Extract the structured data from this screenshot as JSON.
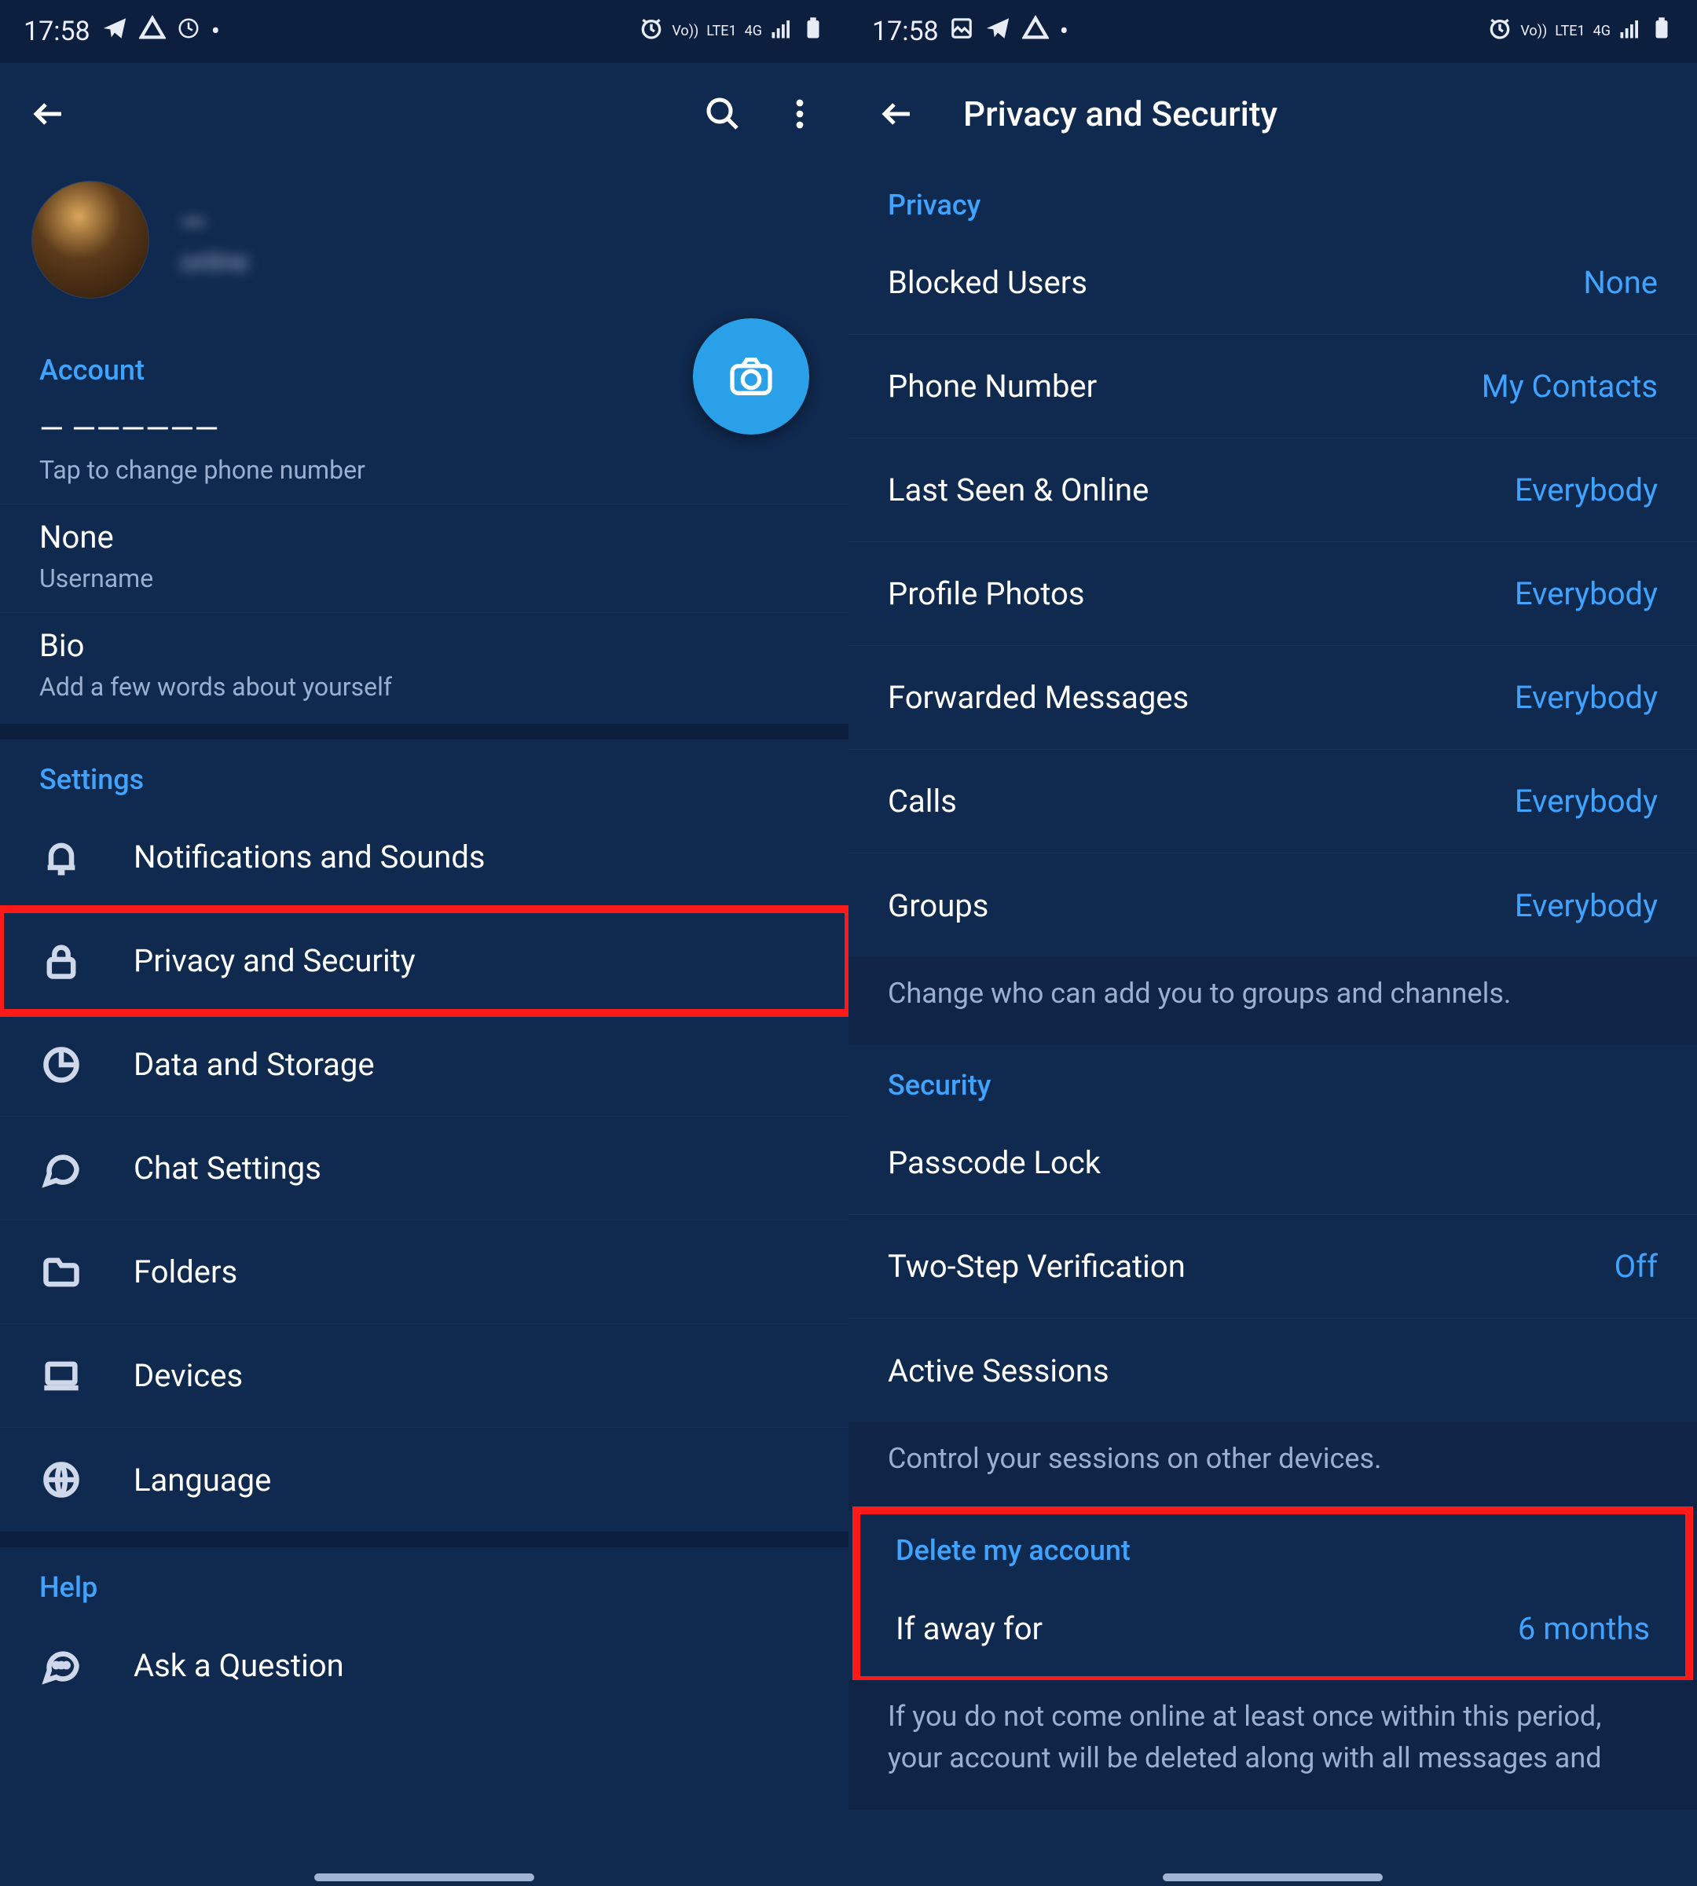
{
  "status": {
    "time": "17:58",
    "vo": "Vo))",
    "lte": "LTE1",
    "net": "4G",
    "dot": "•"
  },
  "left": {
    "profile": {
      "name": "—",
      "sub": "online"
    },
    "account": {
      "header": "Account",
      "phone_value": "— ——————",
      "phone_sub": "Tap to change phone number",
      "username_value": "None",
      "username_label": "Username",
      "bio_value": "Bio",
      "bio_sub": "Add a few words about yourself"
    },
    "settings": {
      "header": "Settings",
      "items": [
        {
          "label": "Notifications and Sounds",
          "icon": "bell"
        },
        {
          "label": "Privacy and Security",
          "icon": "lock",
          "highlight": true
        },
        {
          "label": "Data and Storage",
          "icon": "pie"
        },
        {
          "label": "Chat Settings",
          "icon": "chat"
        },
        {
          "label": "Folders",
          "icon": "folder"
        },
        {
          "label": "Devices",
          "icon": "laptop"
        },
        {
          "label": "Language",
          "icon": "globe"
        }
      ]
    },
    "help": {
      "header": "Help",
      "item": "Ask a Question"
    }
  },
  "right": {
    "title": "Privacy and Security",
    "privacy": {
      "header": "Privacy",
      "rows": [
        {
          "label": "Blocked Users",
          "value": "None"
        },
        {
          "label": "Phone Number",
          "value": "My Contacts"
        },
        {
          "label": "Last Seen & Online",
          "value": "Everybody"
        },
        {
          "label": "Profile Photos",
          "value": "Everybody"
        },
        {
          "label": "Forwarded Messages",
          "value": "Everybody"
        },
        {
          "label": "Calls",
          "value": "Everybody"
        },
        {
          "label": "Groups",
          "value": "Everybody"
        }
      ],
      "hint": "Change who can add you to groups and channels."
    },
    "security": {
      "header": "Security",
      "rows": [
        {
          "label": "Passcode Lock",
          "value": ""
        },
        {
          "label": "Two-Step Verification",
          "value": "Off"
        },
        {
          "label": "Active Sessions",
          "value": ""
        }
      ],
      "hint": "Control your sessions on other devices."
    },
    "delete": {
      "header": "Delete my account",
      "row_label": "If away for",
      "row_value": "6 months",
      "hint": "If you do not come online at least once within this period, your account will be deleted along with all messages and"
    }
  }
}
